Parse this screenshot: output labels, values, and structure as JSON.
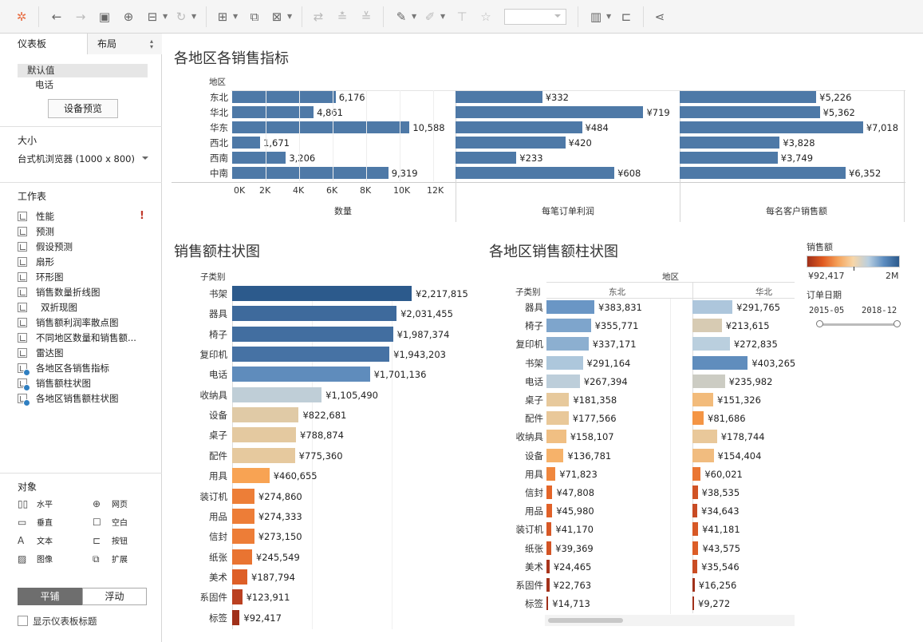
{
  "sidebar": {
    "tab_dashboard": "仪表板",
    "tab_layout": "布局",
    "default_value": "默认值",
    "phone": "电话",
    "preview_button": "设备预览",
    "size_title": "大小",
    "size_value": "台式机浏览器 (1000 x 800)",
    "sheets_title": "工作表",
    "sheets": [
      {
        "label": "性能"
      },
      {
        "label": "预测"
      },
      {
        "label": "假设预测"
      },
      {
        "label": "扇形"
      },
      {
        "label": "环形图"
      },
      {
        "label": "销售数量折线图"
      },
      {
        "label": "双折现图"
      },
      {
        "label": "销售额利润率散点图"
      },
      {
        "label": "不同地区数量和销售额..."
      },
      {
        "label": "雷达图"
      },
      {
        "label": "各地区各销售指标"
      },
      {
        "label": "销售额柱状图"
      },
      {
        "label": "各地区销售额柱状图"
      }
    ],
    "warning": "!",
    "objects_title": "对象",
    "objects": [
      {
        "label": "水平",
        "icon": "horizontal-icon"
      },
      {
        "label": "网页",
        "icon": "web-icon"
      },
      {
        "label": "垂直",
        "icon": "vertical-icon"
      },
      {
        "label": "空白",
        "icon": "blank-icon"
      },
      {
        "label": "文本",
        "icon": "text-icon"
      },
      {
        "label": "按钮",
        "icon": "button-icon"
      },
      {
        "label": "图像",
        "icon": "image-icon"
      },
      {
        "label": "扩展",
        "icon": "extension-icon"
      }
    ],
    "tile_label": "平铺",
    "float_label": "浮动",
    "show_title_label": "显示仪表板标题"
  },
  "colors": {
    "accent": "#4e79a7",
    "blue_dark": "#2c5a8c",
    "orange": "#f28e2b",
    "red_dark": "#b23a1e",
    "toolbar_bg": "#f5f5f5"
  },
  "chart_data": [
    {
      "type": "bar",
      "title": "各地区各销售指标",
      "row_header": "地区",
      "categories": [
        "东北",
        "华北",
        "华东",
        "西北",
        "西南",
        "中南"
      ],
      "series": [
        {
          "name": "数量",
          "values": [
            6176,
            4861,
            10588,
            1671,
            3206,
            9319
          ],
          "labels": [
            "6,176",
            "4,861",
            "10,588",
            "1,671",
            "3,206",
            "9,319"
          ]
        },
        {
          "name": "每笔订单利润",
          "values": [
            332,
            719,
            484,
            420,
            233,
            608
          ],
          "labels": [
            "¥332",
            "¥719",
            "¥484",
            "¥420",
            "¥233",
            "¥608"
          ]
        },
        {
          "name": "每名客户销售额",
          "values": [
            5226,
            5362,
            7018,
            3828,
            3749,
            6352
          ],
          "labels": [
            "¥5,226",
            "¥5,362",
            "¥7,018",
            "¥3,828",
            "¥3,749",
            "¥6,352"
          ]
        }
      ],
      "x_ticks": [
        "0K",
        "2K",
        "4K",
        "6K",
        "8K",
        "10K",
        "12K"
      ],
      "xlim": [
        0,
        12000
      ]
    },
    {
      "type": "bar",
      "title": "销售额柱状图",
      "row_header": "子类别",
      "categories": [
        "书架",
        "器具",
        "椅子",
        "复印机",
        "电话",
        "收纳具",
        "设备",
        "桌子",
        "配件",
        "用具",
        "装订机",
        "用品",
        "信封",
        "纸张",
        "美术",
        "系固件",
        "标签"
      ],
      "values": [
        2217815,
        2031455,
        1987374,
        1943203,
        1701136,
        1105490,
        822681,
        788874,
        775360,
        460655,
        274860,
        274333,
        273150,
        245549,
        187794,
        123911,
        92417
      ],
      "labels": [
        "¥2,217,815",
        "¥2,031,455",
        "¥1,987,374",
        "¥1,943,203",
        "¥1,701,136",
        "¥1,105,490",
        "¥822,681",
        "¥788,874",
        "¥775,360",
        "¥460,655",
        "¥274,860",
        "¥274,333",
        "¥273,150",
        "¥245,549",
        "¥187,794",
        "¥123,911",
        "¥92,417"
      ]
    },
    {
      "type": "bar",
      "title": "各地区销售额柱状图",
      "column_header": "地区",
      "row_header": "子类别",
      "categories": [
        "器具",
        "椅子",
        "复印机",
        "书架",
        "电话",
        "桌子",
        "配件",
        "收纳具",
        "设备",
        "用具",
        "信封",
        "用品",
        "装订机",
        "纸张",
        "美术",
        "系固件",
        "标签"
      ],
      "series": [
        {
          "name": "东北",
          "values": [
            383831,
            355771,
            337171,
            291164,
            267394,
            181358,
            177566,
            158107,
            136781,
            71823,
            47808,
            45980,
            41170,
            39369,
            24465,
            22763,
            14713
          ],
          "labels": [
            "¥383,831",
            "¥355,771",
            "¥337,171",
            "¥291,164",
            "¥267,394",
            "¥181,358",
            "¥177,566",
            "¥158,107",
            "¥136,781",
            "¥71,823",
            "¥47,808",
            "¥45,980",
            "¥41,170",
            "¥39,369",
            "¥24,465",
            "¥22,763",
            "¥14,713"
          ]
        },
        {
          "name": "华北",
          "values": [
            291765,
            213615,
            272835,
            403265,
            235982,
            151326,
            81686,
            178744,
            154404,
            60021,
            38535,
            34643,
            41181,
            43575,
            35546,
            16256,
            9272
          ],
          "labels": [
            "¥291,765",
            "¥213,615",
            "¥272,835",
            "¥403,265",
            "¥235,982",
            "¥151,326",
            "¥81,686",
            "¥178,744",
            "¥154,404",
            "¥60,021",
            "¥38,535",
            "¥34,643",
            "¥41,181",
            "¥43,575",
            "¥35,546",
            "¥16,256",
            "¥9,272"
          ]
        }
      ]
    }
  ],
  "legend": {
    "title": "销售额",
    "min_label": "¥92,417",
    "max_label": "2M",
    "min": 92417,
    "max": 2217815,
    "date_title": "订单日期",
    "date_start": "2015-05",
    "date_end": "2018-12"
  }
}
